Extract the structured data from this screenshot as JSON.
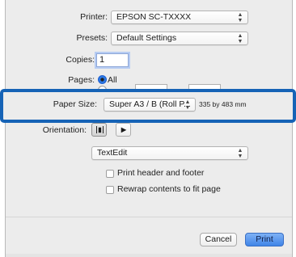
{
  "printer": {
    "label": "Printer:",
    "value": "EPSON SC-TXXXX"
  },
  "presets": {
    "label": "Presets:",
    "value": "Default Settings"
  },
  "copies": {
    "label": "Copies:",
    "value": "1"
  },
  "pages": {
    "label": "Pages:",
    "option_all": "All"
  },
  "paper_size": {
    "label": "Paper Size:",
    "value": "Super A3 / B (Roll P...",
    "dimensions": "335 by 483 mm"
  },
  "orientation": {
    "label": "Orientation:",
    "selected": "portrait"
  },
  "app_menu": {
    "value": "TextEdit"
  },
  "options": {
    "print_header_footer": {
      "label": "Print header and footer",
      "checked": false
    },
    "rewrap_contents": {
      "label": "Rewrap contents to fit page",
      "checked": false
    }
  },
  "buttons": {
    "cancel": "Cancel",
    "print": "Print"
  },
  "colors": {
    "highlight_frame": "#1663b6",
    "dialog_bg": "#ececec",
    "primary_button": "#4a8dec"
  }
}
